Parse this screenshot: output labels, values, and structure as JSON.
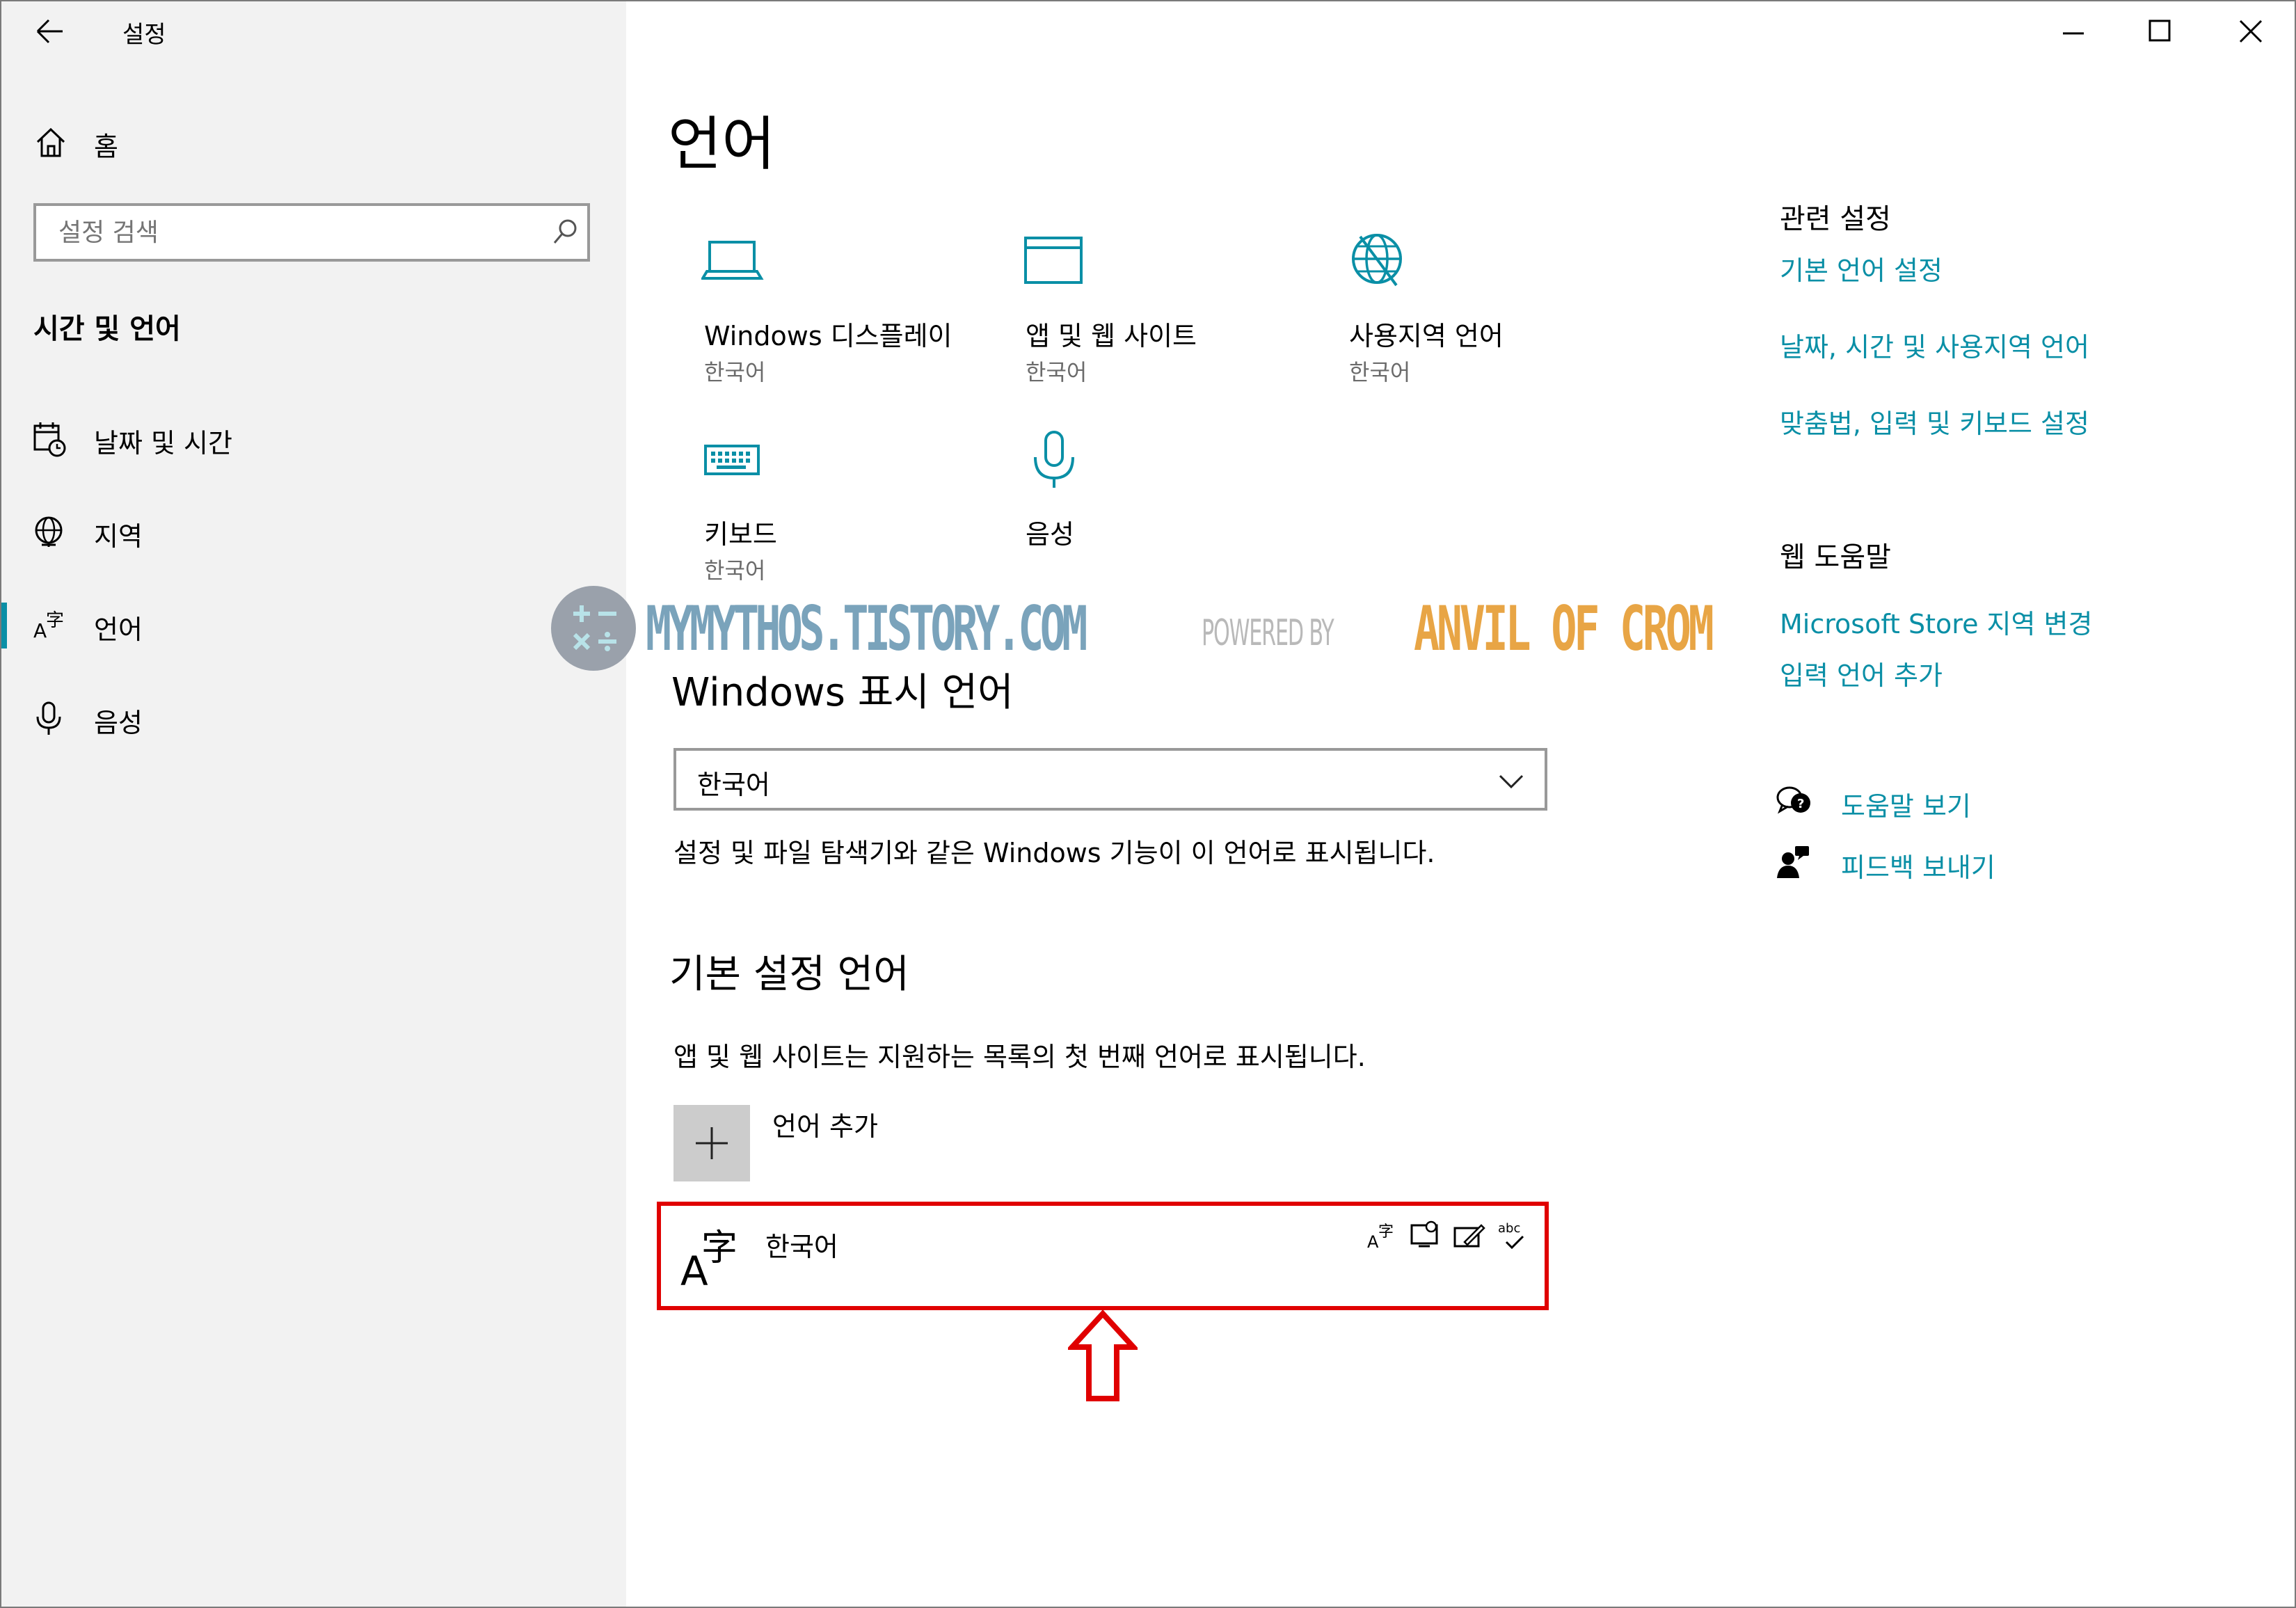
{
  "window": {
    "title": "설정"
  },
  "sidebar": {
    "home_label": "홈",
    "search_placeholder": "설정 검색",
    "section_title": "시간 및 언어",
    "items": [
      {
        "label": "날짜 및 시간",
        "icon": "calendar-clock-icon"
      },
      {
        "label": "지역",
        "icon": "globe-icon"
      },
      {
        "label": "언어",
        "icon": "language-icon",
        "selected": true
      },
      {
        "label": "음성",
        "icon": "microphone-icon"
      }
    ]
  },
  "main": {
    "title": "언어",
    "tiles": [
      {
        "title": "Windows 디스플레이",
        "value": "한국어",
        "icon": "laptop-icon"
      },
      {
        "title": "앱 및 웹 사이트",
        "value": "한국어",
        "icon": "browser-window-icon"
      },
      {
        "title": "사용지역 언어",
        "value": "한국어",
        "icon": "globe-pin-icon"
      },
      {
        "title": "키보드",
        "value": "한국어",
        "icon": "keyboard-icon"
      },
      {
        "title": "음성",
        "value": "",
        "icon": "microphone-icon"
      }
    ],
    "display_language": {
      "heading": "Windows 표시 언어",
      "selected": "한국어",
      "description": "설정 및 파일 탐색기와 같은 Windows 기능이 이 언어로 표시됩니다."
    },
    "preferred": {
      "heading": "기본 설정 언어",
      "description": "앱 및 웹 사이트는 지원하는 목록의 첫 번째 언어로 표시됩니다.",
      "add_label": "언어 추가",
      "languages": [
        {
          "name": "한국어",
          "features": [
            "display-language-icon",
            "speech-icon",
            "handwriting-icon",
            "spellcheck-icon"
          ]
        }
      ]
    }
  },
  "related": {
    "heading": "관련 설정",
    "links": [
      "기본 언어 설정",
      "날짜, 시간 및 사용지역 언어",
      "맞춤법, 입력 및 키보드 설정"
    ]
  },
  "web_help": {
    "heading": "웹 도움말",
    "links": [
      "Microsoft Store 지역 변경",
      "입력 언어 추가"
    ]
  },
  "support": {
    "help_label": "도움말 보기",
    "feedback_label": "피드백 보내기"
  },
  "watermark": {
    "site": "MYMYTHOS.TISTORY.COM",
    "powered": "POWERED BY",
    "brand": "ANVIL OF CROM"
  },
  "colors": {
    "accent": "#0a8fa6",
    "highlight": "#e00000",
    "sidebar_bg": "#f2f2f2"
  }
}
